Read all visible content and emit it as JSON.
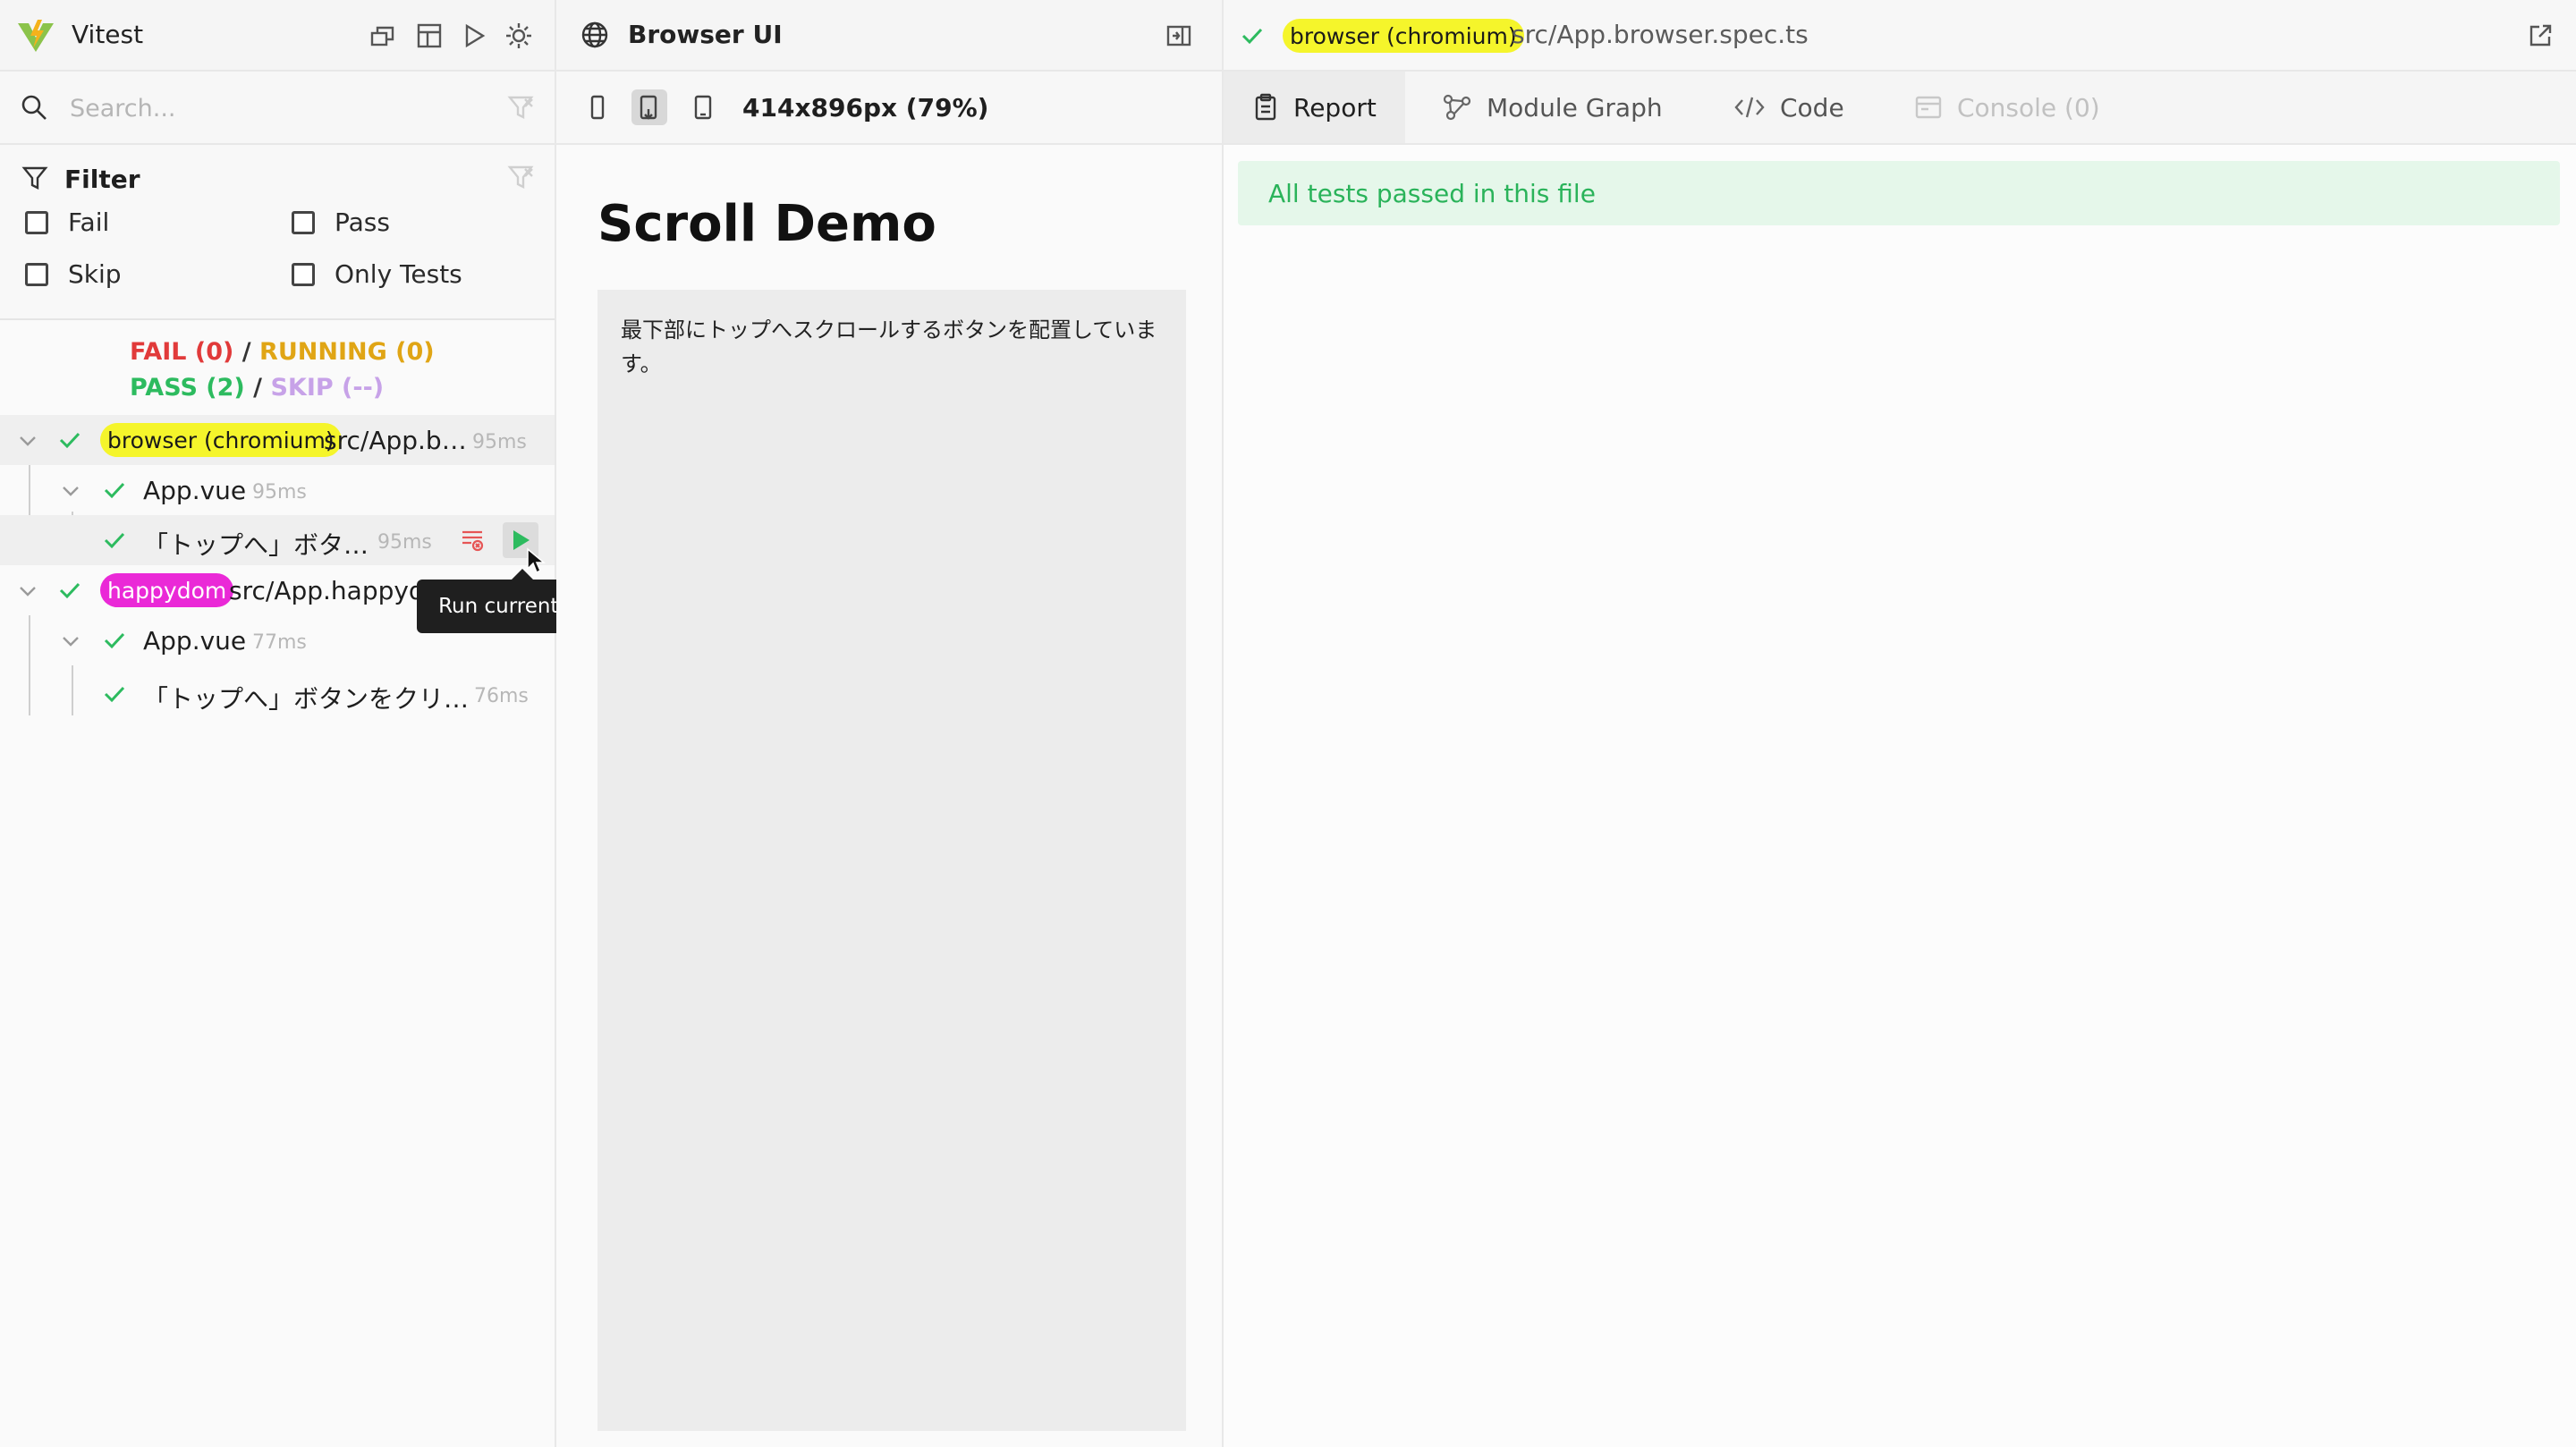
{
  "sidebar": {
    "app_title": "Vitest",
    "search_placeholder": "Search...",
    "filter": {
      "title": "Filter",
      "options": [
        "Fail",
        "Pass",
        "Skip",
        "Only Tests"
      ]
    },
    "summary": {
      "fail": "FAIL (0)",
      "running": "RUNNING (0)",
      "pass": "PASS (2)",
      "skip": "SKIP (--)",
      "separator": "/"
    },
    "tree": [
      {
        "badge": "browser (chromium)",
        "label": "src/App.b…",
        "duration": "95ms"
      },
      {
        "label": "App.vue",
        "duration": "95ms"
      },
      {
        "label": "「トップへ」ボタ…",
        "duration": "95ms"
      },
      {
        "badge": "happydom",
        "label": "src/App.happydo…"
      },
      {
        "label": "App.vue",
        "duration": "77ms"
      },
      {
        "label": "「トップへ」ボタンをクリ…",
        "duration": "76ms"
      }
    ],
    "tooltip": "Run current test"
  },
  "browser_panel": {
    "title": "Browser UI",
    "viewport_label": "414x896px (79%)",
    "preview": {
      "heading": "Scroll Demo",
      "body_text": "最下部にトップへスクロールするボタンを配置しています。"
    }
  },
  "report_panel": {
    "badge": "browser (chromium)",
    "file_path": "src/App.browser.spec.ts",
    "tabs": [
      "Report",
      "Module Graph",
      "Code",
      "Console (0)"
    ],
    "active_tab": "Report",
    "status_message": "All tests passed in this file"
  },
  "colors": {
    "pass": "#2dbb5f",
    "fail": "#e13a3a",
    "running": "#e0a515",
    "skip": "#c7a2e8",
    "chromium_badge": "#f5f52b",
    "happydom_badge": "#ea29d7"
  }
}
